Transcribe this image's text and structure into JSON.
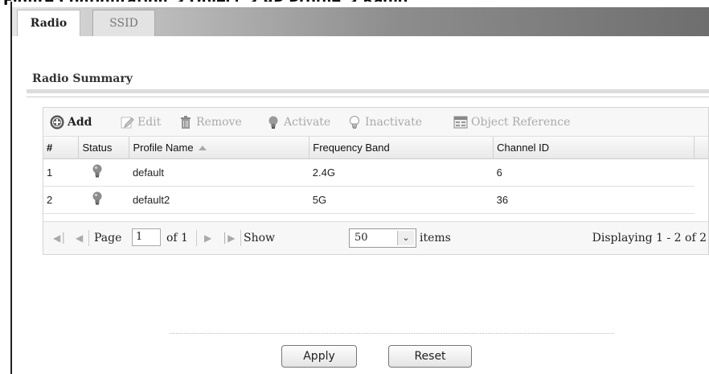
{
  "tabs": [
    {
      "label": "Radio",
      "active": true
    },
    {
      "label": "SSID",
      "active": false
    }
  ],
  "section": {
    "title": "Radio Summary"
  },
  "toolbar": {
    "add": "Add",
    "edit": "Edit",
    "remove": "Remove",
    "activate": "Activate",
    "inactivate": "Inactivate",
    "object_reference": "Object Reference"
  },
  "table": {
    "headers": [
      "#",
      "Status",
      "Profile Name",
      "Frequency Band",
      "Channel ID"
    ],
    "sorted_column": "Profile Name",
    "rows": [
      {
        "index": "1",
        "status": "inactive",
        "profile_name": "default",
        "frequency_band": "2.4G",
        "channel_id": "6"
      },
      {
        "index": "2",
        "status": "inactive",
        "profile_name": "default2",
        "frequency_band": "5G",
        "channel_id": "36"
      }
    ]
  },
  "pager": {
    "page_label": "Page",
    "page_value": "1",
    "of_label": "of 1",
    "show_label": "Show",
    "items_per_page": "50",
    "items_label": "items",
    "displaying": "Displaying 1 - 2 of 2"
  },
  "buttons": {
    "apply": "Apply",
    "reset": "Reset"
  },
  "colors": {
    "disabled_text": "#aaaaaa",
    "bulb_gray": "#8c8c8c"
  }
}
